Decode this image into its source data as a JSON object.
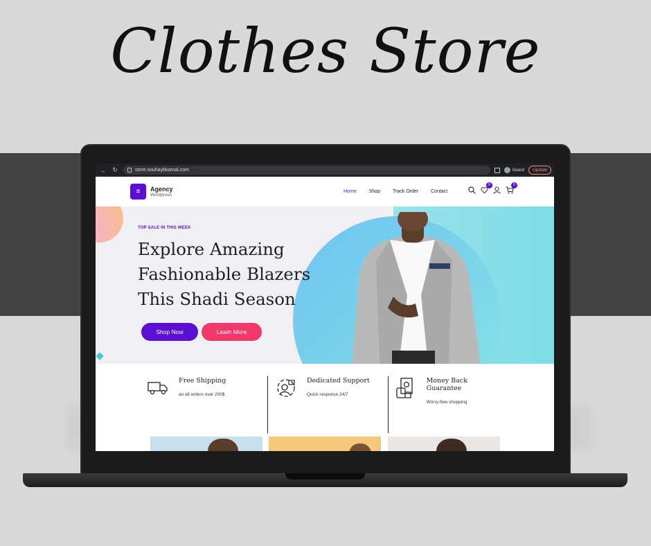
{
  "headline": "Clothes Store",
  "browser": {
    "url": "store.souhaybkamal.com",
    "profile_label": "Guest",
    "update_label": "Update"
  },
  "site": {
    "logo_title": "Agency",
    "logo_subtitle": "Wordpress",
    "nav": [
      {
        "label": "Home",
        "active": true
      },
      {
        "label": "Shop",
        "active": false
      },
      {
        "label": "Track Order",
        "active": false
      },
      {
        "label": "Contact",
        "active": false
      }
    ],
    "wishlist_count": "0",
    "cart_count": "0"
  },
  "hero": {
    "kicker": "TOP SALE IN THIS WEEK",
    "title_lines": [
      "Explore Amazing",
      "Fashionable Blazers",
      "This Shadi Season"
    ],
    "primary_button": "Shop Now",
    "secondary_button": "Learn More"
  },
  "features": [
    {
      "title": "Free Shipping",
      "subtitle": "an all orders over 200$",
      "icon": "truck-icon"
    },
    {
      "title": "Dedicated Support",
      "subtitle": "Quick response 24/7",
      "icon": "support-agent-icon"
    },
    {
      "title": "Money Back Guarantee",
      "subtitle": "Worry-free shopping",
      "icon": "money-back-icon"
    }
  ],
  "colors": {
    "brand": "#5b0fd1",
    "accent": "#f0386b",
    "hero_bg": "#f0eff4",
    "band": "#434343",
    "page_bg": "#d9d9d9"
  }
}
